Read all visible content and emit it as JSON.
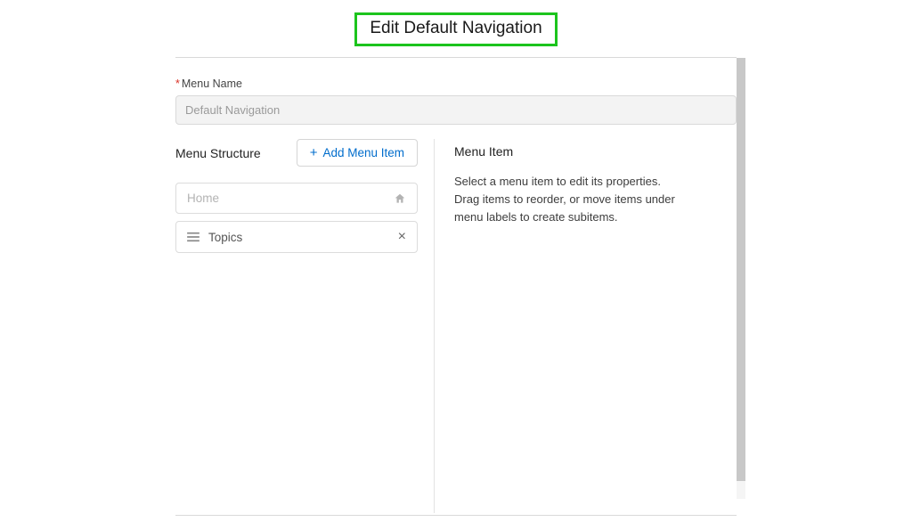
{
  "header": {
    "title": "Edit Default Navigation"
  },
  "form": {
    "menu_name_label": "Menu Name",
    "menu_name_value": "Default Navigation"
  },
  "structure": {
    "heading": "Menu Structure",
    "add_label": "Add Menu Item",
    "items": [
      {
        "label": "Home",
        "fixed": true
      },
      {
        "label": "Topics",
        "fixed": false
      }
    ]
  },
  "details": {
    "heading": "Menu Item",
    "help_text": "Select a menu item to edit its properties. Drag items to reorder, or move items under menu labels to create subitems."
  }
}
